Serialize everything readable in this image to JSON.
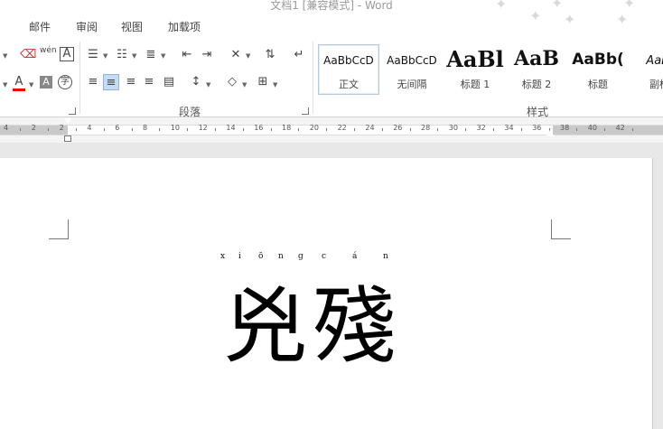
{
  "window": {
    "title": "文档1 [兼容模式] - Word"
  },
  "tabs": [
    "邮件",
    "审阅",
    "视图",
    "加载项"
  ],
  "ribbon": {
    "groups": {
      "paragraph": "段落",
      "styles": "样式"
    },
    "font_icons": {
      "wen": "wén",
      "char_border": "A",
      "color_a": "A",
      "shade_a": "A",
      "enclose": "字"
    },
    "styles": [
      {
        "sample": "AaBbCcD",
        "name": "正文"
      },
      {
        "sample": "AaBbCcD",
        "name": "无间隔"
      },
      {
        "sample": "AaBl",
        "name": "标题 1"
      },
      {
        "sample": "AaB",
        "name": "标题 2"
      },
      {
        "sample": "AaBb(",
        "name": "标题"
      },
      {
        "sample": "AaBl",
        "name": "副标"
      }
    ],
    "colors": {
      "font_color": "#ff0000",
      "selected": "#c5dcf3"
    }
  },
  "ruler": {
    "labels": [
      "4",
      "2",
      "2",
      "4",
      "6",
      "8",
      "10",
      "12",
      "14",
      "16",
      "18",
      "20",
      "22",
      "24",
      "26",
      "28",
      "30",
      "32",
      "34",
      "36",
      "38",
      "40",
      "42"
    ]
  },
  "document": {
    "pinyin": [
      "x",
      "i",
      "ō",
      "n",
      "g",
      "c",
      "á",
      "n"
    ],
    "text": "兇殘"
  }
}
